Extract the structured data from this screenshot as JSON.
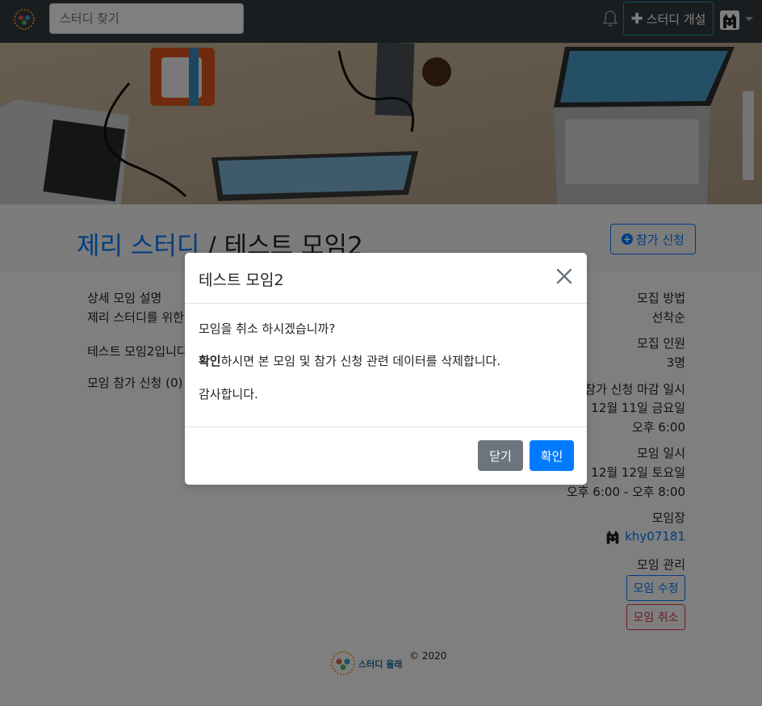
{
  "navbar": {
    "search_placeholder": "스터디 찾기",
    "create_study_label": "스터디 개설"
  },
  "study": {
    "study_name": "제리 스터디",
    "separator": " / ",
    "event_name": "테스트 모임2",
    "join_button": "참가 신청"
  },
  "left": {
    "desc_heading": "상세 모임 설명",
    "desc_line1": "제리 스터디를 위한",
    "desc_line2": "테스트 모임2입니다",
    "participants": "모임 참가 신청 (0)"
  },
  "right": {
    "method_label": "모집 방법",
    "method_value": "선착순",
    "limit_label": "모집 인원",
    "limit_value": "3명",
    "deadline_label": "참가 신청 마감 일시",
    "deadline_date": "12월 11일 금요일",
    "deadline_time": "오후 6:00",
    "event_label": "모임 일시",
    "event_date": "12월 12일 토요일",
    "event_time": "오후 6:00 - 오후 8:00",
    "host_label": "모임장",
    "host_name": "khy07181",
    "manage_label": "모임 관리",
    "edit_button": "모임 수정",
    "cancel_button": "모임 취소"
  },
  "footer": {
    "logo_text": "스터디 올래",
    "copyright": "© 2020"
  },
  "modal": {
    "title": "테스트 모임2",
    "line1": "모임을 취소 하시겠습니까?",
    "line2_bold": "확인",
    "line2_rest": "하시면 본 모임 및 참가 신청 관련 데이터를 삭제합니다.",
    "line3": "감사합니다.",
    "close_button": "닫기",
    "confirm_button": "확인"
  },
  "colors": {
    "primary": "#007bff",
    "danger": "#dc3545",
    "secondary": "#6c757d",
    "navbar": "#343a40"
  }
}
